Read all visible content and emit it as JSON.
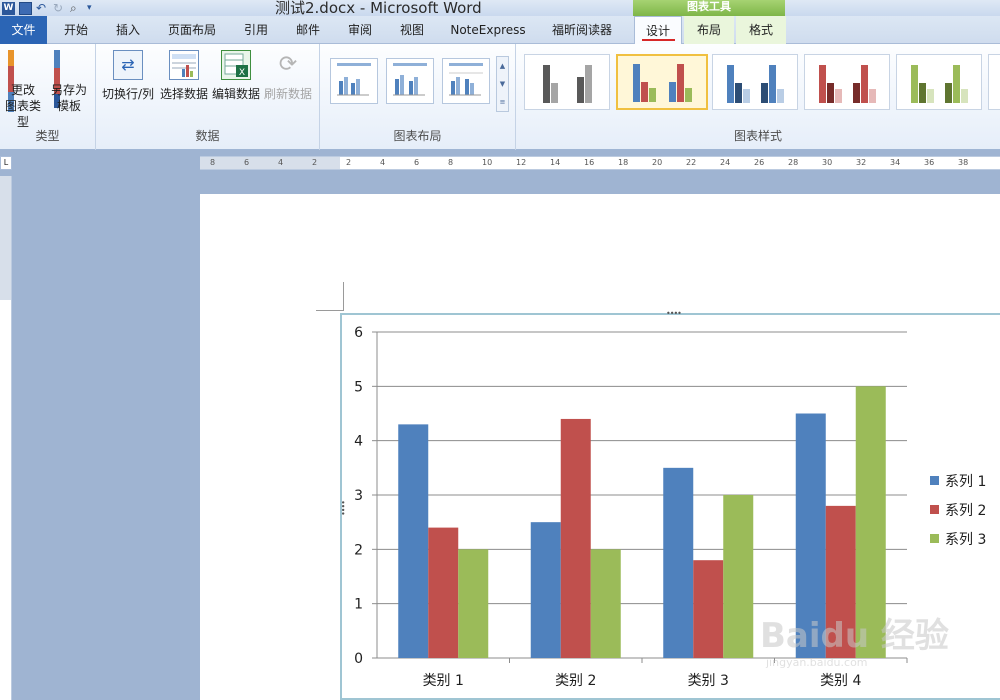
{
  "window": {
    "title": "测试2.docx - Microsoft Word",
    "context_tool_title": "图表工具"
  },
  "tabs": [
    {
      "label": "文件"
    },
    {
      "label": "开始"
    },
    {
      "label": "插入"
    },
    {
      "label": "页面布局"
    },
    {
      "label": "引用"
    },
    {
      "label": "邮件"
    },
    {
      "label": "审阅"
    },
    {
      "label": "视图"
    },
    {
      "label": "NoteExpress"
    },
    {
      "label": "福昕阅读器"
    },
    {
      "label": "设计"
    },
    {
      "label": "布局"
    },
    {
      "label": "格式"
    }
  ],
  "ribbon": {
    "type_group": {
      "label": "类型",
      "change_type_line1": "更改",
      "change_type_line2": "图表类型",
      "save_template_line1": "另存为",
      "save_template_line2": "模板"
    },
    "data_group": {
      "label": "数据",
      "switch_row_col": "切换行/列",
      "select_data": "选择数据",
      "edit_data": "编辑数据",
      "refresh_data": "刷新数据"
    },
    "layout_group": {
      "label": "图表布局"
    },
    "style_group": {
      "label": "图表样式"
    }
  },
  "ruler": {
    "numbers": [
      "8",
      "6",
      "4",
      "2",
      "2",
      "4",
      "6",
      "8",
      "10",
      "12",
      "14",
      "16",
      "18",
      "20",
      "22",
      "24",
      "26",
      "28",
      "30",
      "32",
      "34",
      "36",
      "38"
    ]
  },
  "colors": {
    "series1": "#4f81bd",
    "series2": "#c0504d",
    "series3": "#9bbb59",
    "accent_file_tab": "#2b65b5",
    "context_green": "#79b243"
  },
  "chart_data": {
    "type": "bar",
    "categories": [
      "类别 1",
      "类别 2",
      "类别 3",
      "类别 4"
    ],
    "series": [
      {
        "name": "系列 1",
        "values": [
          4.3,
          2.5,
          3.5,
          4.5
        ]
      },
      {
        "name": "系列 2",
        "values": [
          2.4,
          4.4,
          1.8,
          2.8
        ]
      },
      {
        "name": "系列 3",
        "values": [
          2,
          2,
          3,
          5
        ]
      }
    ],
    "ylim": [
      0,
      6
    ],
    "yticks": [
      "0",
      "1",
      "2",
      "3",
      "4",
      "5",
      "6"
    ],
    "grid": true,
    "legend": "right"
  },
  "watermark": {
    "logo": "Baidu 经验",
    "sub": "jingyan.baidu.com"
  }
}
